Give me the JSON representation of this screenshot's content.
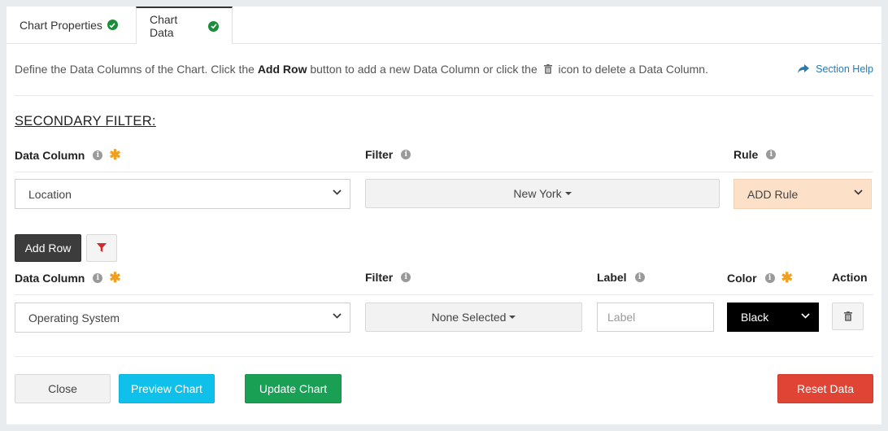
{
  "tabs": [
    {
      "label": "Chart Properties"
    },
    {
      "label": "Chart Data"
    }
  ],
  "description": {
    "before": "Define the Data Columns of the Chart. Click the ",
    "bold": "Add Row",
    "middle": " button to add a new Data Column or click the ",
    "after": " icon to delete a Data Column."
  },
  "section_help": "Section Help",
  "secondary_filter": {
    "title": "SECONDARY FILTER:",
    "headers": {
      "data_column": "Data Column",
      "filter": "Filter",
      "rule": "Rule"
    },
    "data_column_value": "Location",
    "filter_value": "New York",
    "rule_value": "ADD Rule"
  },
  "add_row_label": "Add Row",
  "rows_table": {
    "headers": {
      "data_column": "Data Column",
      "filter": "Filter",
      "label": "Label",
      "color": "Color",
      "action": "Action"
    },
    "row": {
      "data_column": "Operating System",
      "filter": "None Selected",
      "label_placeholder": "Label",
      "color": "Black"
    }
  },
  "footer": {
    "close": "Close",
    "preview": "Preview Chart",
    "update": "Update Chart",
    "reset": "Reset Data"
  },
  "colors": {
    "preview": "#0fc1ea",
    "update": "#1aa055",
    "reset": "#e04434",
    "rule_bg": "#fde0c8",
    "dark_button": "#3c3c3c"
  }
}
